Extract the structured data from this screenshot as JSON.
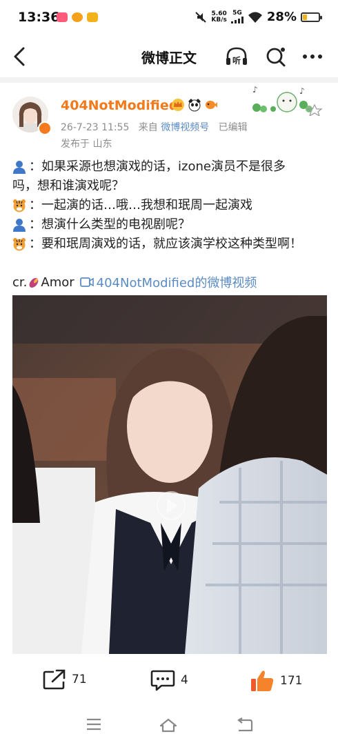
{
  "status_bar": {
    "time": "13:36",
    "speed_value": "5.60",
    "speed_unit": "KB/s",
    "network": "5G",
    "battery": "28%",
    "battery_level": 0.28
  },
  "nav": {
    "title": "微博正文",
    "listen_label": "听"
  },
  "post": {
    "username": "404NotModified",
    "date": "26-7-23 11:55",
    "source_prefix": "来自",
    "source": "微博视频号",
    "edited": "已编辑",
    "location": "发布于 山东",
    "lines": [
      "：如果采源也想演戏的话，izone演员不是很多",
      "吗，想和谁演戏呢？",
      "：一起演的话…哦…我想和珉周一起演戏",
      "：想演什么类型的电视剧呢？",
      "：要和珉周演戏的话，就应该演学校这种类型啊！"
    ],
    "credit_prefix": "cr.",
    "credit_name": "Amor",
    "video_link": "404NotModified的微博视频"
  },
  "actions": {
    "repost_count": "71",
    "comment_count": "4",
    "like_count": "171"
  },
  "colors": {
    "accent_orange": "#f07a1c",
    "link_blue": "#5b8bc4",
    "meta_gray": "#8d8d8d"
  }
}
